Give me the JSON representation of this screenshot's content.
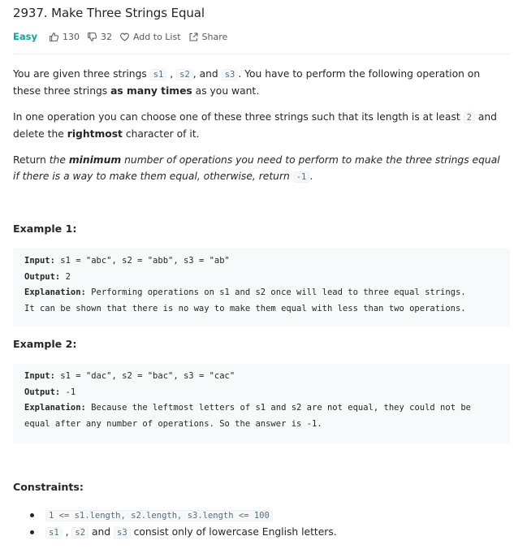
{
  "problem": {
    "title": "2937. Make Three Strings Equal",
    "difficulty": "Easy",
    "likes": "130",
    "dislikes": "32",
    "add_to_list": "Add to List",
    "share": "Share",
    "colors": {
      "easy": "#00af9b"
    }
  },
  "description": {
    "p1_a": "You are given three strings ",
    "s1": "s1",
    "sep1": " , ",
    "s2": "s2",
    "sep2": ", and ",
    "s3": "s3",
    "p1_b": ". You have to perform the following operation on these three strings ",
    "p1_bold": "as many times",
    "p1_c": " as you want.",
    "p2_a": "In one operation you can choose one of these three strings such that its length is at least ",
    "p2_code": "2",
    "p2_b": " and delete the ",
    "p2_bold": "rightmost",
    "p2_c": " character of it.",
    "p3_a": "Return ",
    "p3_the": "the ",
    "p3_bold": "minimum",
    "p3_b": " number of operations you need to perform to make the three strings equal if there is a way to make them equal, otherwise, return ",
    "p3_code": "-1",
    "p3_c": "."
  },
  "examples": [
    {
      "heading": "Example 1:",
      "input_label": "Input:",
      "input": " s1 = \"abc\", s2 = \"abb\", s3 = \"ab\"",
      "output_label": "Output:",
      "output": " 2",
      "explanation_label": "Explanation:",
      "explanation_1": " Performing operations on s1 and s2 once will lead to three equal strings.",
      "explanation_2": "It can be shown that there is no way to make them equal with less than two operations."
    },
    {
      "heading": "Example 2:",
      "input_label": "Input:",
      "input": " s1 = \"dac\", s2 = \"bac\", s3 = \"cac\"",
      "output_label": "Output:",
      "output": " -1",
      "explanation_label": "Explanation:",
      "explanation_1": " Because the leftmost letters of s1 and s2 are not equal, they could not be",
      "explanation_2": "equal after any number of operations. So the answer is -1."
    }
  ],
  "constraints": {
    "heading": "Constraints:",
    "c1": "1 <= s1.length, s2.length, s3.length <= 100",
    "c2_s1": "s1",
    "c2_sep": " , ",
    "c2_s2": "s2",
    "c2_and": " and ",
    "c2_s3": "s3",
    "c2_rest": " consist only of lowercase English letters."
  }
}
